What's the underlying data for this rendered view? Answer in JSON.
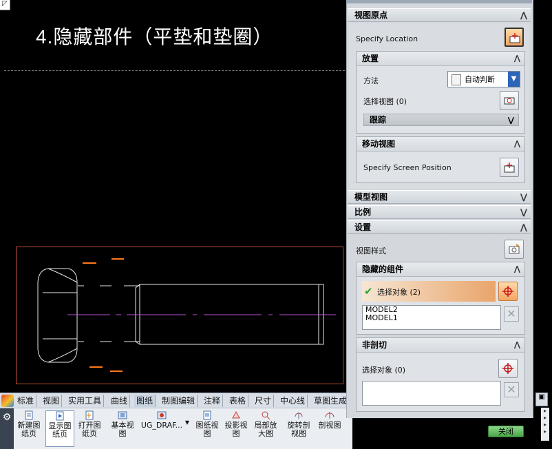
{
  "canvas": {
    "title_num": "4.",
    "title_text": "隐藏部件（平垫和垫圈）",
    "frame_color": "#c0502d",
    "dimension_color": "#ff7a1a",
    "centerline_color": "#b84fd6"
  },
  "dialog": {
    "sections": {
      "view_origin": "视图原点",
      "model_view": "模型视图",
      "scale": "比例",
      "settings": "设置"
    },
    "specify_location": "Specify Location",
    "placement": {
      "title": "放置",
      "method_label": "方法",
      "method_value": "自动判断",
      "select_view_label": "选择视图 (0)",
      "tracking": "跟踪"
    },
    "move_view": {
      "title": "移动视图",
      "specify_screen_position": "Specify Screen Position"
    },
    "view_style_label": "视图样式",
    "hidden_components": {
      "title": "隐藏的组件",
      "select_label": "选择对象 (2)",
      "items": [
        "MODEL2",
        "MODEL1"
      ]
    },
    "non_section": {
      "title": "非剖切",
      "select_label": "选择对象 (0)"
    },
    "close_button": "关闭"
  },
  "toolbar": {
    "tabs": [
      "标准",
      "视图",
      "实用工具",
      "曲线",
      "图纸",
      "制图编辑",
      "注释",
      "表格",
      "尺寸",
      "中心线",
      "草图生成"
    ],
    "active_tab_index": 4,
    "buttons": [
      {
        "label1": "新建图",
        "label2": "纸页"
      },
      {
        "label1": "显示图",
        "label2": "纸页"
      },
      {
        "label1": "打开图",
        "label2": "纸页"
      },
      {
        "label1": "基本视",
        "label2": "图"
      },
      {
        "label1": "UG_DRAF...",
        "label2": ""
      },
      {
        "label1": "图纸视",
        "label2": "图"
      },
      {
        "label1": "投影视",
        "label2": "图"
      },
      {
        "label1": "局部放",
        "label2": "大图"
      },
      {
        "label1": "旋转剖",
        "label2": "视图"
      },
      {
        "label1": "剖视图",
        "label2": ""
      }
    ]
  }
}
